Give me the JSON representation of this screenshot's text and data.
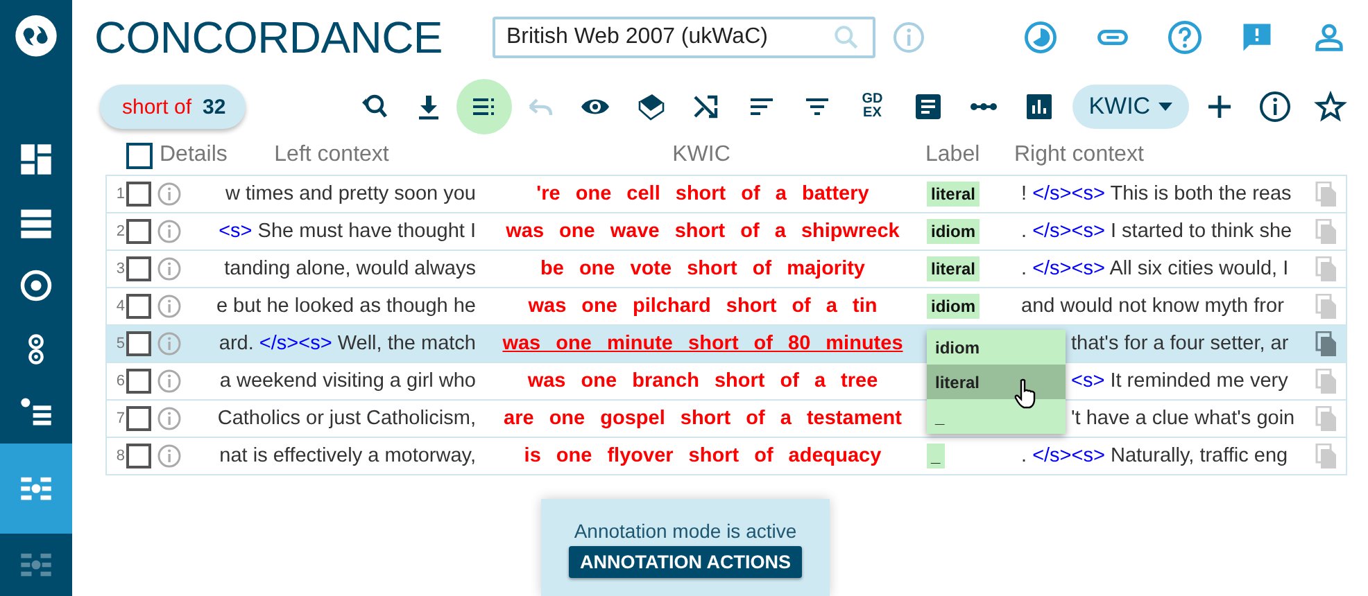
{
  "sidebar": {
    "items": [
      {
        "kind": "dashboard",
        "selected": false,
        "disabled": false
      },
      {
        "kind": "list",
        "selected": false,
        "disabled": false
      },
      {
        "kind": "target",
        "selected": false,
        "disabled": false
      },
      {
        "kind": "collocation",
        "selected": false,
        "disabled": false
      },
      {
        "kind": "bullets",
        "selected": false,
        "disabled": false
      },
      {
        "kind": "concordance",
        "selected": true,
        "disabled": false
      },
      {
        "kind": "parallel",
        "selected": false,
        "disabled": true
      }
    ]
  },
  "header": {
    "title": "CONCORDANCE",
    "corpus_field": {
      "value": "British Web 2007 (ukWaC)"
    }
  },
  "query_chip": {
    "query": "short of",
    "count": "32"
  },
  "toolbar": [
    {
      "kind": "search-back",
      "selected": false,
      "disabled": false
    },
    {
      "kind": "download",
      "selected": false,
      "disabled": false
    },
    {
      "kind": "annotate",
      "selected": true,
      "disabled": false
    },
    {
      "kind": "undo",
      "selected": false,
      "disabled": true
    },
    {
      "kind": "eye",
      "selected": false,
      "disabled": false
    },
    {
      "kind": "book",
      "selected": false,
      "disabled": false
    },
    {
      "kind": "shuffle",
      "selected": false,
      "disabled": false
    },
    {
      "kind": "sort",
      "selected": false,
      "disabled": false
    },
    {
      "kind": "filter",
      "selected": false,
      "disabled": false
    },
    {
      "kind": "gdex",
      "selected": false,
      "disabled": false,
      "lines": [
        "GD",
        "EX"
      ]
    },
    {
      "kind": "note",
      "selected": false,
      "disabled": false
    },
    {
      "kind": "dots",
      "selected": false,
      "disabled": false
    },
    {
      "kind": "chart",
      "selected": false,
      "disabled": false
    }
  ],
  "view_dropdown": {
    "value": "KWIC"
  },
  "table": {
    "select_all_checked": false,
    "columns": [
      "Details",
      "Left context",
      "KWIC",
      "Label",
      "Right context"
    ],
    "rows": [
      {
        "number": "1",
        "checked": false,
        "selected": false,
        "left": [
          {
            "kind": "text",
            "text": "w times and pretty soon you"
          }
        ],
        "kwic": "'re one cell short of a battery",
        "label": "literal",
        "right": [
          {
            "kind": "text",
            "text": "! "
          },
          {
            "kind": "tag",
            "text": "</s><s>"
          },
          {
            "kind": "text",
            "text": " This is both the reas"
          }
        ]
      },
      {
        "number": "2",
        "checked": false,
        "selected": false,
        "left": [
          {
            "kind": "tag",
            "text": "<s>"
          },
          {
            "kind": "text",
            "text": " She must have thought I"
          }
        ],
        "kwic": "was one wave short of a shipwreck",
        "label": "idiom",
        "right": [
          {
            "kind": "text",
            "text": ". "
          },
          {
            "kind": "tag",
            "text": "</s><s>"
          },
          {
            "kind": "text",
            "text": " I started to think she"
          }
        ]
      },
      {
        "number": "3",
        "checked": false,
        "selected": false,
        "left": [
          {
            "kind": "text",
            "text": "tanding alone, would always"
          }
        ],
        "kwic": "be one vote short of majority",
        "label": "literal",
        "right": [
          {
            "kind": "text",
            "text": ". "
          },
          {
            "kind": "tag",
            "text": "</s><s>"
          },
          {
            "kind": "text",
            "text": " All six cities would, I"
          }
        ]
      },
      {
        "number": "4",
        "checked": false,
        "selected": false,
        "left": [
          {
            "kind": "text",
            "text": "e but he looked as though he"
          }
        ],
        "kwic": "was one pilchard short of a tin",
        "label": "idiom",
        "right": [
          {
            "kind": "text",
            "text": "and would not know myth fror"
          }
        ]
      },
      {
        "number": "5",
        "checked": false,
        "selected": true,
        "left": [
          {
            "kind": "text",
            "text": "ard. "
          },
          {
            "kind": "tag",
            "text": "</s><s>"
          },
          {
            "kind": "text",
            "text": " Well, the match"
          }
        ],
        "kwic": "was one minute short of 80 minutes",
        "right": [
          {
            "kind": "text",
            "text": "that's for a four setter, ar"
          }
        ],
        "label_menu": {
          "options": [
            {
              "text": "idiom",
              "selected": false
            },
            {
              "text": "literal",
              "selected": true
            },
            {
              "text": "_",
              "selected": false
            }
          ]
        }
      },
      {
        "number": "6",
        "checked": false,
        "selected": false,
        "left": [
          {
            "kind": "text",
            "text": "a weekend visiting a girl who"
          }
        ],
        "kwic": "was one branch short of a tree",
        "right": [
          {
            "kind": "tag",
            "text": "<s>"
          },
          {
            "kind": "text",
            "text": " It reminded me very"
          }
        ]
      },
      {
        "number": "7",
        "checked": false,
        "selected": false,
        "left": [
          {
            "kind": "text",
            "text": "Catholics or just Catholicism,"
          }
        ],
        "kwic": "are one gospel short of a testament",
        "right": [
          {
            "kind": "text",
            "text": "'t have a clue what's goin"
          }
        ]
      },
      {
        "number": "8",
        "checked": false,
        "selected": false,
        "left": [
          {
            "kind": "text",
            "text": "nat is effectively a motorway,"
          }
        ],
        "kwic": "is one flyover short of adequacy",
        "label": "_",
        "right": [
          {
            "kind": "text",
            "text": ". "
          },
          {
            "kind": "tag",
            "text": "</s><s>"
          },
          {
            "kind": "text",
            "text": " Naturally, traffic eng"
          }
        ]
      }
    ]
  },
  "annotation_notice": {
    "message": "Annotation mode is active",
    "button": "ANNOTATION ACTIONS"
  }
}
